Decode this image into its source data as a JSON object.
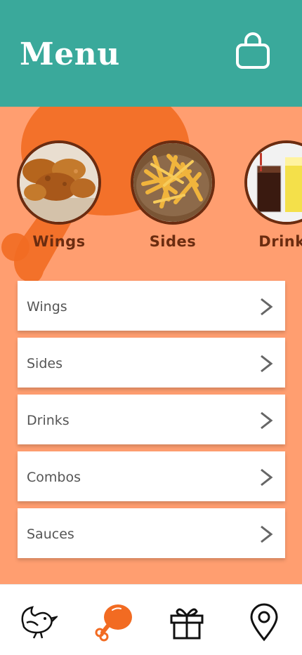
{
  "header": {
    "title": "Menu",
    "cart_icon": "shopping-bag-icon"
  },
  "categories": [
    {
      "label": "Wings"
    },
    {
      "label": "Sides"
    },
    {
      "label": "Drinks"
    }
  ],
  "menu_list": [
    {
      "label": "Wings"
    },
    {
      "label": "Sides"
    },
    {
      "label": "Drinks"
    },
    {
      "label": "Combos"
    },
    {
      "label": "Sauces"
    }
  ],
  "bottom_nav": [
    {
      "icon": "bird-logo-icon",
      "active": false
    },
    {
      "icon": "drumstick-icon",
      "active": true
    },
    {
      "icon": "gift-icon",
      "active": false
    },
    {
      "icon": "location-pin-icon",
      "active": false
    }
  ],
  "colors": {
    "header": "#3aa99b",
    "content_bg": "#ff9e70",
    "accent": "#f26b22",
    "category_border": "#6b2c10"
  }
}
